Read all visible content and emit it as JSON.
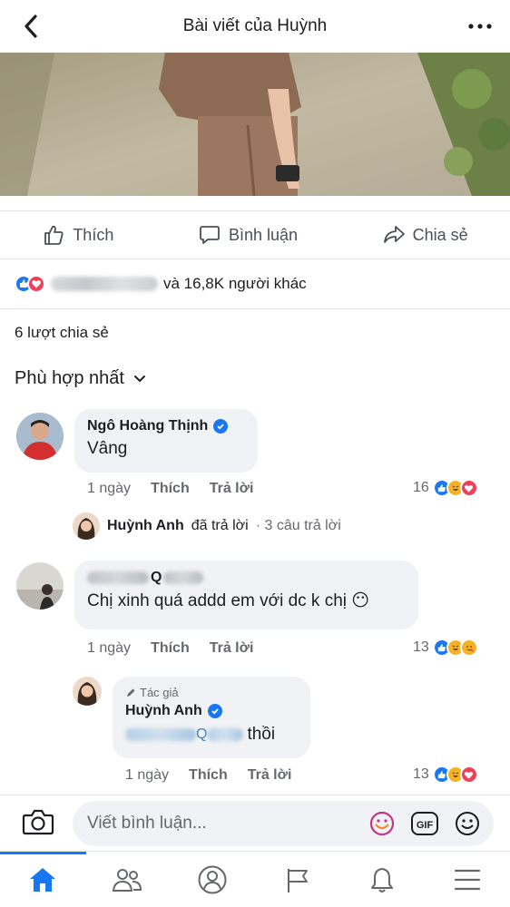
{
  "header": {
    "title": "Bài viết của Huỳnh"
  },
  "actions": {
    "like": "Thích",
    "comment": "Bình luận",
    "share": "Chia sẻ"
  },
  "reactions": {
    "others_text": "và 16,8K người khác"
  },
  "shares_text": "6 lượt chia sẻ",
  "sort_label": "Phù hợp nhất",
  "comments": [
    {
      "author": "Ngô Hoàng Thịnh",
      "text": "Vâng",
      "time": "1 ngày",
      "like": "Thích",
      "reply": "Trả lời",
      "reaction_count": "16",
      "replies_summary": {
        "author": "Huỳnh Anh",
        "action": "đã trả lời",
        "count": "· 3 câu trả lời"
      }
    },
    {
      "author_visible": "Q",
      "text": "Chị xinh quá addd em với dc k chị 😶",
      "time": "1 ngày",
      "like": "Thích",
      "reply": "Trả lời",
      "reaction_count": "13"
    }
  ],
  "reply": {
    "badge": "Tác giả",
    "author": "Huỳnh Anh",
    "mention_visible": "Q",
    "text_end": "thồi",
    "time": "1 ngày",
    "like": "Thích",
    "reply": "Trả lời",
    "reaction_count": "13"
  },
  "composer": {
    "placeholder": "Viết bình luận..."
  },
  "colors": {
    "accent": "#1877f2",
    "love": "#f33e58",
    "haha": "#f7b125"
  },
  "tabs": [
    "home-icon",
    "friends-icon",
    "profile-icon",
    "pages-icon",
    "notifications-icon",
    "menu-icon"
  ]
}
